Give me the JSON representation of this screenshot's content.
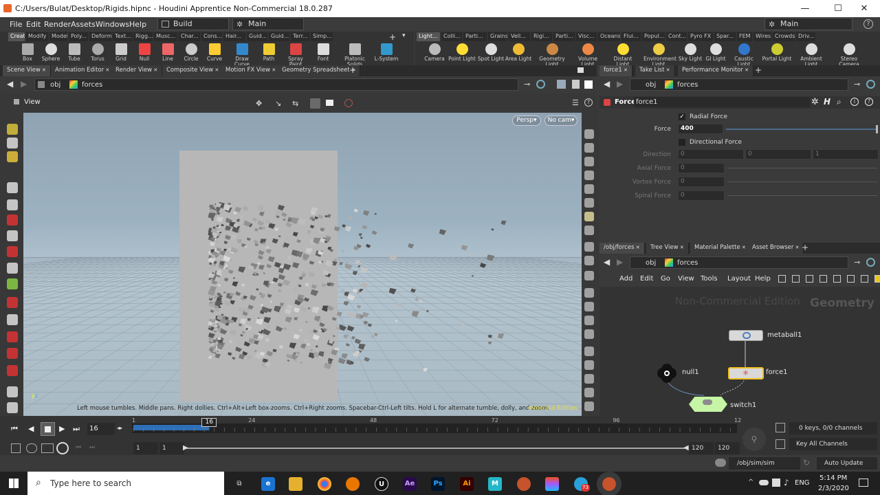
{
  "window": {
    "title": "C:/Users/Bulat/Desktop/Rigids.hipnc - Houdini Apprentice Non-Commercial 18.0.287",
    "minimize": "—",
    "maximize": "☐",
    "close": "✕"
  },
  "menu": {
    "items": [
      "File",
      "Edit",
      "Render",
      "Assets",
      "Windows",
      "Help"
    ],
    "desktop": "Build",
    "main": "Main",
    "main_right": "Main"
  },
  "shelf_left": {
    "tabs": [
      "Create",
      "Modify",
      "Model",
      "Poly...",
      "Deform",
      "Text...",
      "Rigg...",
      "Musc...",
      "Char...",
      "Cons...",
      "Hair...",
      "Guid...",
      "Guid...",
      "Terr...",
      "Simp..."
    ],
    "tools": [
      "Box",
      "Sphere",
      "Tube",
      "Torus",
      "Grid",
      "Null",
      "Line",
      "Circle",
      "Curve",
      "Draw Curve",
      "Path",
      "Spray Paint",
      "Font",
      "Platonic Solids",
      "L-System"
    ]
  },
  "shelf_right": {
    "tabs": [
      "Light...",
      "Colli...",
      "Parti...",
      "Grains",
      "Vell...",
      "Rigi...",
      "Parti...",
      "Visc...",
      "Oceans",
      "Flui...",
      "Popul...",
      "Cont...",
      "Pyro FX",
      "Spar...",
      "FEM",
      "Wires",
      "Crowds",
      "Driv..."
    ],
    "tools": [
      "Camera",
      "Point Light",
      "Spot Light",
      "Area Light",
      "Geometry Light",
      "Volume Light",
      "Distant Light",
      "Environment Light",
      "Sky Light",
      "GI Light",
      "Caustic Light",
      "Portal Light",
      "Ambient Light",
      "Stereo Camera"
    ]
  },
  "left_tabs": [
    "Scene View",
    "Animation Editor",
    "Render View",
    "Composite View",
    "Motion FX View",
    "Geometry Spreadsheet"
  ],
  "path": {
    "root": "obj",
    "node": "forces"
  },
  "viewer": {
    "title": "View",
    "persp": "Persp",
    "cam": "No cam",
    "status": "Left mouse tumbles. Middle pans. Right dollies. Ctrl+Alt+Left box-zooms. Ctrl+Right zooms. Spacebar-Ctrl-Left tilts. Hold L for alternate tumble, dolly, and zoom.",
    "watermark": "mmercial Edition"
  },
  "param_tabs": [
    "force1",
    "Take List",
    "Performance Monitor"
  ],
  "params": {
    "type": "Force",
    "name": "force1",
    "radial": "Radial Force",
    "force_label": "Force",
    "force_value": "400",
    "force_fraction": 0.4,
    "directional": "Directional Force",
    "direction": "Direction",
    "dir_vals": [
      "0",
      "0",
      "1"
    ],
    "axial": "Axial Force",
    "vortex": "Vortex Force",
    "spiral": "Spiral Force",
    "zero": "0"
  },
  "net_tabs": [
    "/obj/forces",
    "Tree View",
    "Material Palette",
    "Asset Browser"
  ],
  "net": {
    "menu": [
      "Add",
      "Edit",
      "Go",
      "View",
      "Tools",
      "Layout",
      "Help"
    ],
    "watermark": "Non-Commercial Edition",
    "context": "Geometry",
    "nodes": {
      "metaball": "metaball1",
      "force": "force1",
      "null": "null1",
      "switch": "switch1"
    }
  },
  "timeline": {
    "frame": "16",
    "cur": "16",
    "ticks": [
      "1",
      "24",
      "48",
      "72",
      "96",
      "12"
    ],
    "start": "1",
    "start2": "1",
    "end": "120",
    "end2": "120",
    "keys": "0 keys, 0/0 channels",
    "key_all": "Key All Channels",
    "simpath": "/obj/sim/sim",
    "update": "Auto Update"
  },
  "taskbar": {
    "search": "Type here to search",
    "lang": "ENG",
    "time": "5:14 PM",
    "date": "2/3/2020",
    "badge": "73"
  }
}
